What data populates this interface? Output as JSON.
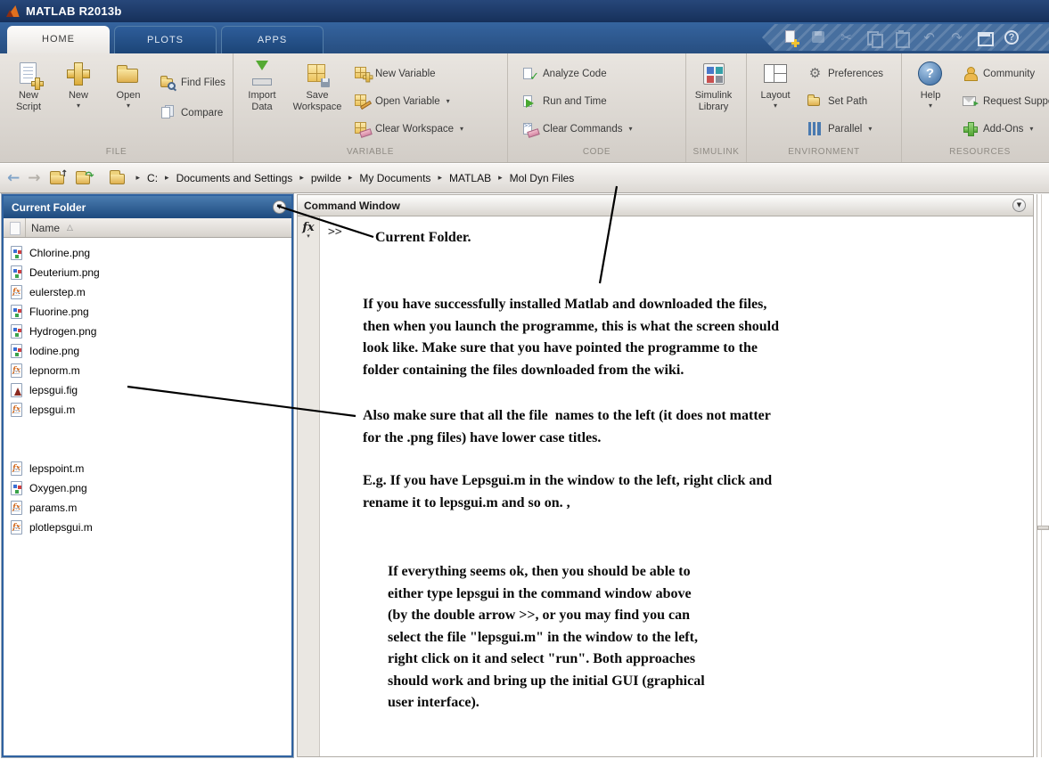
{
  "titlebar": {
    "title": "MATLAB R2013b"
  },
  "tabs": {
    "home": "HOME",
    "plots": "PLOTS",
    "apps": "APPS"
  },
  "ribbon": {
    "file": {
      "label": "FILE",
      "new_script": "New Script",
      "new": "New",
      "open": "Open",
      "find_files": "Find Files",
      "compare": "Compare"
    },
    "variable": {
      "label": "VARIABLE",
      "import_data": "Import Data",
      "save_workspace": "Save Workspace",
      "new_variable": "New Variable",
      "open_variable": "Open Variable",
      "clear_workspace": "Clear Workspace"
    },
    "code": {
      "label": "CODE",
      "analyze_code": "Analyze Code",
      "run_and_time": "Run and Time",
      "clear_commands": "Clear Commands"
    },
    "simulink": {
      "label": "SIMULINK",
      "simulink_library": "Simulink Library"
    },
    "environment": {
      "label": "ENVIRONMENT",
      "layout": "Layout",
      "preferences": "Preferences",
      "set_path": "Set Path",
      "parallel": "Parallel"
    },
    "resources": {
      "label": "RESOURCES",
      "help": "Help",
      "community": "Community",
      "request_support": "Request Support",
      "add_ons": "Add-Ons"
    }
  },
  "addressbar": {
    "segments": [
      "C:",
      "Documents and Settings",
      "pwilde",
      "My Documents",
      "MATLAB",
      "Mol Dyn Files"
    ]
  },
  "current_folder": {
    "title": "Current Folder",
    "name_column": "Name",
    "files": [
      {
        "name": "Chlorine.png",
        "type": "png"
      },
      {
        "name": "Deuterium.png",
        "type": "png"
      },
      {
        "name": "eulerstep.m",
        "type": "m"
      },
      {
        "name": "Fluorine.png",
        "type": "png"
      },
      {
        "name": "Hydrogen.png",
        "type": "png"
      },
      {
        "name": "Iodine.png",
        "type": "png"
      },
      {
        "name": "lepnorm.m",
        "type": "m"
      },
      {
        "name": "lepsgui.fig",
        "type": "fig"
      },
      {
        "name": "lepsgui.m",
        "type": "m"
      },
      {
        "name": "lepspoint.m",
        "type": "m"
      },
      {
        "name": "Oxygen.png",
        "type": "png"
      },
      {
        "name": "params.m",
        "type": "m"
      },
      {
        "name": "plotlepsgui.m",
        "type": "m"
      }
    ]
  },
  "command_window": {
    "title": "Command Window",
    "prompt": ">>",
    "fx_label": "fx"
  },
  "icons": {
    "dropdown": "▾",
    "breadcrumb_sep": "▸",
    "sort_asc": "△",
    "panel_menu": "▼",
    "back_arrow": "←",
    "forward_arrow": "→",
    "up_arrow": "↑",
    "redo_curl": "↷",
    "cut": "✂",
    "undo": "↶",
    "redo": "↷",
    "gear": "⚙",
    "question_mark": "?"
  },
  "annotations": {
    "current_folder_label": "Current Folder.",
    "para1_lines": [
      "If you have successfully installed Matlab and downloaded the files,",
      "then when you launch the programme, this is what the screen should",
      "look like. Make sure that you have pointed the programme to the",
      "folder containing the files downloaded from the wiki."
    ],
    "para2_lines": [
      "Also make sure that all the file  names to the left (it does not matter",
      "for the .png files) have lower case titles."
    ],
    "para3_lines": [
      "E.g. If you have Lepsgui.m in the window to the left, right click and",
      "rename it to lepsgui.m and so on. ,"
    ],
    "para4_lines": [
      "If everything seems ok, then you should be able to",
      "either type lepsgui in the command window above",
      "(by the double arrow >>, or you may find you can",
      "select the file \"lepsgui.m\" in the window to the left,",
      "right click on it and select \"run\". Both approaches",
      "should work and bring up the initial GUI (graphical",
      "user interface)."
    ]
  }
}
